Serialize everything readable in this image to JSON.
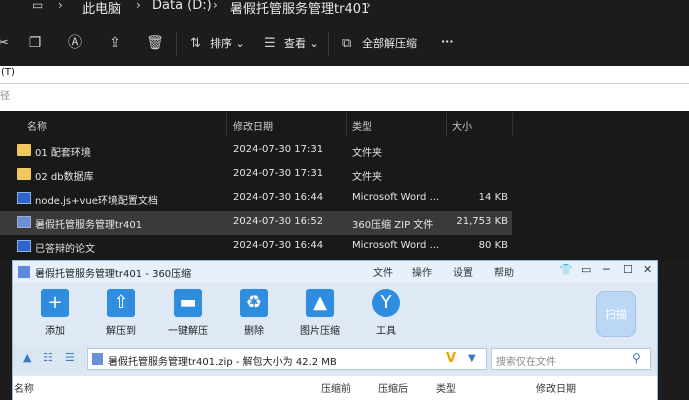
{
  "address": {
    "items": [
      "此电脑",
      "Data (D:)",
      "暑假托管服务管理tr401"
    ]
  },
  "toolbar": {
    "sort": "排序",
    "view": "查看",
    "extract_all": "全部解压缩",
    "more": "···"
  },
  "menu": {
    "text": "(T)",
    "text2": "径"
  },
  "columns": {
    "name": "名称",
    "date": "修改日期",
    "type": "类型",
    "size": "大小"
  },
  "files": [
    {
      "name": "01 配套环境",
      "date": "2024-07-30 17:31",
      "type": "文件夹",
      "size": "",
      "icon": "folder"
    },
    {
      "name": "02 db数据库",
      "date": "2024-07-30 17:31",
      "type": "文件夹",
      "size": "",
      "icon": "folder"
    },
    {
      "name": "node.js+vue环境配置文档",
      "date": "2024-07-30 16:44",
      "type": "Microsoft Word ...",
      "size": "14 KB",
      "icon": "doc"
    },
    {
      "name": "暑假托管服务管理tr401",
      "date": "2024-07-30 16:52",
      "type": "360压缩 ZIP 文件",
      "size": "21,753 KB",
      "icon": "zip"
    },
    {
      "name": "已答辩的论文",
      "date": "2024-07-30 16:44",
      "type": "Microsoft Word ...",
      "size": "80 KB",
      "icon": "doc"
    }
  ],
  "zip": {
    "title": "暑假托管服务管理tr401 - 360压缩",
    "menu": [
      "文件",
      "操作",
      "设置",
      "帮助"
    ],
    "tools": [
      "添加",
      "解压到",
      "一键解压",
      "删除",
      "图片压缩",
      "工具"
    ],
    "scan": "扫描",
    "path": "暑假托管服务管理tr401.zip - 解包大小为 42.2 MB",
    "search_placeholder": "搜索仅在文件",
    "columns": [
      "名称",
      "压缩前",
      "压缩后",
      "类型",
      "修改日期"
    ]
  }
}
